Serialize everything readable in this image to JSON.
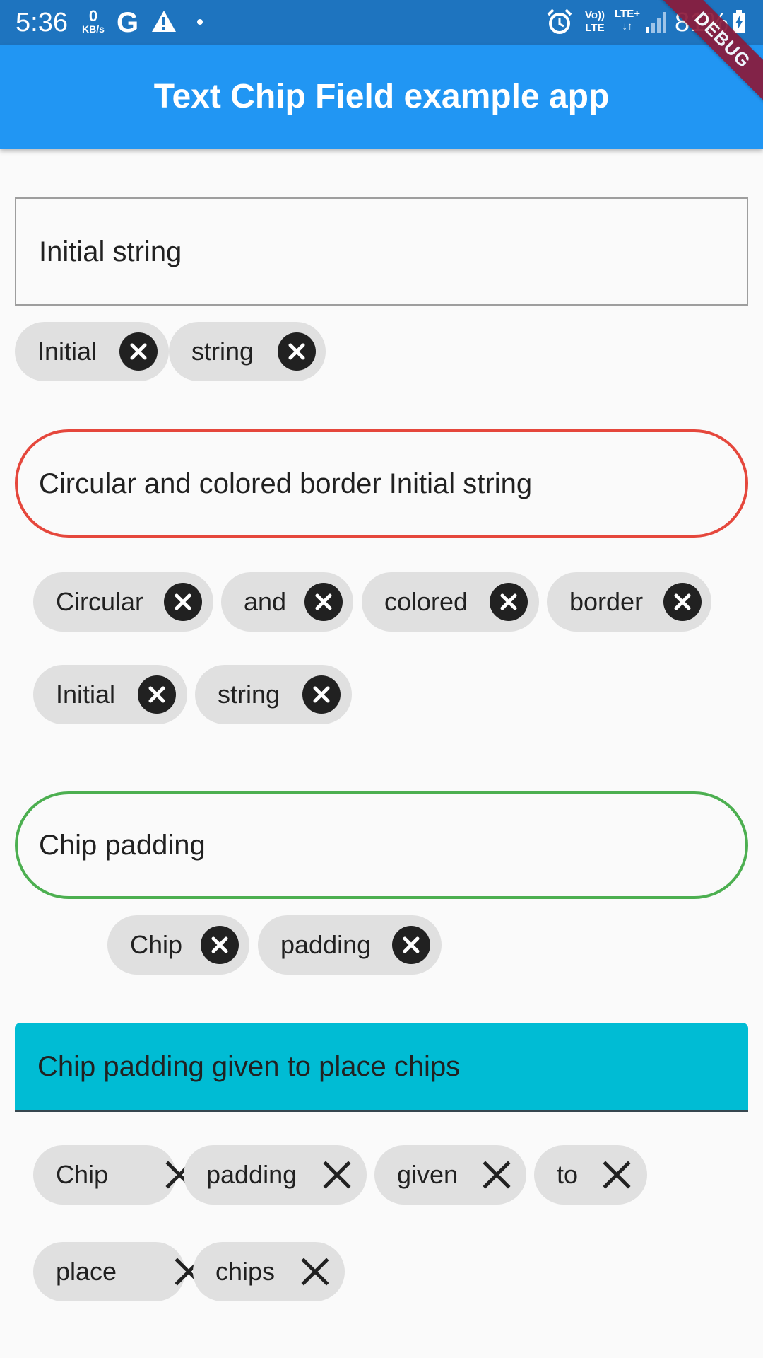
{
  "status_bar": {
    "time": "5:36",
    "net_speed_value": "0",
    "net_speed_unit": "KB/s",
    "g_icon": "google-icon",
    "volte_top": "Vo))",
    "volte_bottom": "LTE",
    "lte_label": "LTE+",
    "battery_percent": "81%"
  },
  "app_bar": {
    "title": "Text Chip Field example app"
  },
  "debug_banner": {
    "label": "DEBUG"
  },
  "fields": {
    "field1": {
      "value": "Initial string"
    },
    "field2": {
      "value": "Circular and colored border Initial string",
      "border_color": "#e5473c"
    },
    "field3": {
      "value": "Chip padding",
      "border_color": "#4caf50"
    },
    "field4": {
      "value": "Chip padding given to place chips",
      "fill_color": "#00bcd4"
    }
  },
  "chips": {
    "group1": [
      "Initial",
      "string"
    ],
    "group2": [
      "Circular",
      "and",
      "colored",
      "border",
      "Initial",
      "string"
    ],
    "group3": [
      "Chip",
      "padding"
    ],
    "group4": [
      "Chip",
      "padding",
      "given",
      "to",
      "place",
      "chips"
    ]
  },
  "colors": {
    "app_bar": "#2196f3",
    "status_bar": "#1e74bf",
    "chip_bg": "#e0e0e0",
    "chip_delete_bg": "#212121"
  },
  "icons": {
    "chip_delete_filled": "cancel-circle-icon",
    "chip_delete_plain": "close-icon"
  }
}
